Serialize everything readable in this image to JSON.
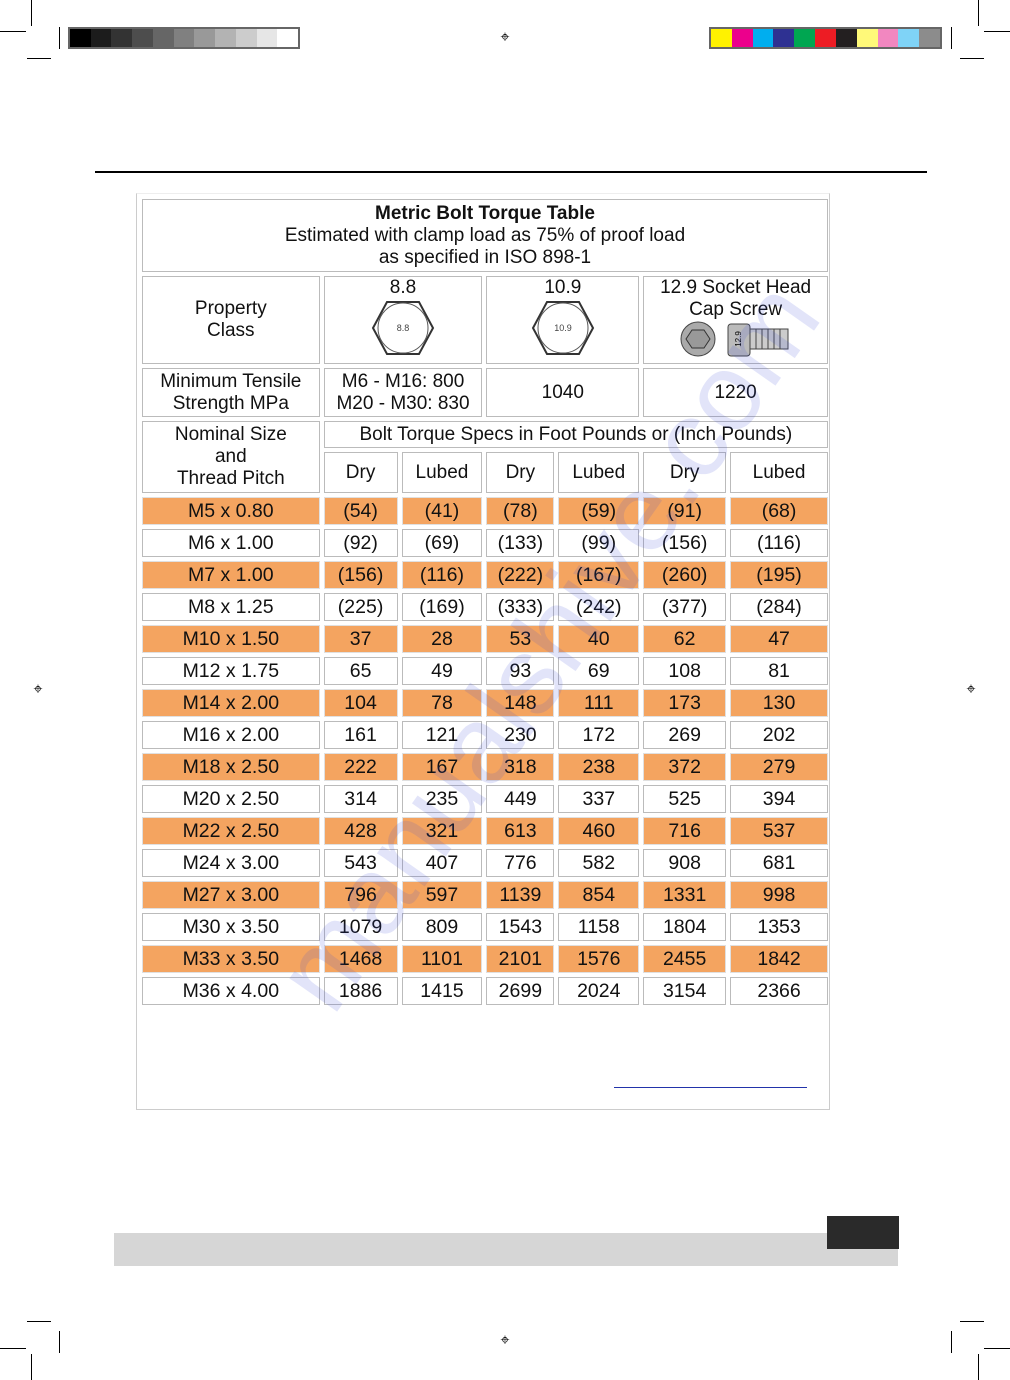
{
  "print_marks": {
    "gray_swatches": [
      "#000000",
      "#1c1c1c",
      "#333333",
      "#4d4d4d",
      "#666666",
      "#808080",
      "#999999",
      "#b3b3b3",
      "#cccccc",
      "#e6e6e6",
      "#ffffff"
    ],
    "color_swatches": [
      "#fff200",
      "#ec008c",
      "#00aeef",
      "#2e3192",
      "#00a651",
      "#ed1c24",
      "#231f20",
      "#fff979",
      "#f287c0",
      "#7fd3f7",
      "#8c8c8c"
    ]
  },
  "table": {
    "title": "Metric Bolt Torque Table",
    "subtitle1": "Estimated with clamp load as 75% of proof load",
    "subtitle2": "as specified in ISO 898-1",
    "property_class_label1": "Property",
    "property_class_label2": "Class",
    "classes": [
      {
        "label": "8.8",
        "icon": "hex-bolt-head-icon",
        "mark": "8.8"
      },
      {
        "label": "10.9",
        "icon": "hex-bolt-head-icon",
        "mark": "10.9"
      },
      {
        "label1": "12.9 Socket Head",
        "label2": "Cap Screw",
        "icon": "socket-cap-screw-icon",
        "mark": "12.9"
      }
    ],
    "tensile_label1": "Minimum Tensile",
    "tensile_label2": "Strength MPa",
    "tensile_88_line1": "M6 - M16:  800",
    "tensile_88_line2": "M20 - M30:  830",
    "tensile_109": "1040",
    "tensile_129": "1220",
    "nominal_label1": "Nominal Size",
    "nominal_label2": "and",
    "nominal_label3": "Thread Pitch",
    "torque_header": "Bolt Torque Specs in Foot Pounds or (Inch Pounds)",
    "sub_headers": [
      "Dry",
      "Lubed",
      "Dry",
      "Lubed",
      "Dry",
      "Lubed"
    ],
    "highlight_color": "#f4a460",
    "rows": [
      [
        "M5 x 0.80",
        "(54)",
        "(41)",
        "(78)",
        "(59)",
        "(91)",
        "(68)"
      ],
      [
        "M6 x 1.00",
        "(92)",
        "(69)",
        "(133)",
        "(99)",
        "(156)",
        "(116)"
      ],
      [
        "M7 x 1.00",
        "(156)",
        "(116)",
        "(222)",
        "(167)",
        "(260)",
        "(195)"
      ],
      [
        "M8 x 1.25",
        "(225)",
        "(169)",
        "(333)",
        "(242)",
        "(377)",
        "(284)"
      ],
      [
        "M10 x 1.50",
        "37",
        "28",
        "53",
        "40",
        "62",
        "47"
      ],
      [
        "M12 x 1.75",
        "65",
        "49",
        "93",
        "69",
        "108",
        "81"
      ],
      [
        "M14 x 2.00",
        "104",
        "78",
        "148",
        "111",
        "173",
        "130"
      ],
      [
        "M16 x 2.00",
        "161",
        "121",
        "230",
        "172",
        "269",
        "202"
      ],
      [
        "M18 x 2.50",
        "222",
        "167",
        "318",
        "238",
        "372",
        "279"
      ],
      [
        "M20 x 2.50",
        "314",
        "235",
        "449",
        "337",
        "525",
        "394"
      ],
      [
        "M22 x 2.50",
        "428",
        "321",
        "613",
        "460",
        "716",
        "537"
      ],
      [
        "M24 x 3.00",
        "543",
        "407",
        "776",
        "582",
        "908",
        "681"
      ],
      [
        "M27 x 3.00",
        "796",
        "597",
        "1139",
        "854",
        "1331",
        "998"
      ],
      [
        "M30 x 3.50",
        "1079",
        "809",
        "1543",
        "1158",
        "1804",
        "1353"
      ],
      [
        "M33 x 3.50",
        "1468",
        "1101",
        "2101",
        "1576",
        "2455",
        "1842"
      ],
      [
        "M36 x 4.00",
        "1886",
        "1415",
        "2699",
        "2024",
        "3154",
        "2366"
      ]
    ]
  },
  "watermark": "manualshive.com"
}
